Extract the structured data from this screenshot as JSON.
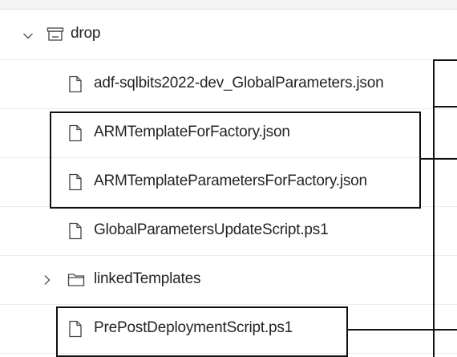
{
  "tree": {
    "root": {
      "label": "drop",
      "expanded": true
    },
    "items": [
      {
        "label": "adf-sqlbits2022-dev_GlobalParameters.json",
        "type": "file"
      },
      {
        "label": "ARMTemplateForFactory.json",
        "type": "file"
      },
      {
        "label": "ARMTemplateParametersForFactory.json",
        "type": "file"
      },
      {
        "label": "GlobalParametersUpdateScript.ps1",
        "type": "file"
      },
      {
        "label": "linkedTemplates",
        "type": "folder",
        "expanded": false
      },
      {
        "label": "PrePostDeploymentScript.ps1",
        "type": "file"
      }
    ]
  },
  "icons": {
    "root_toggle": "chevron-down-icon",
    "root_icon": "artifact-icon",
    "file_icon": "file-icon",
    "folder_toggle": "chevron-right-icon",
    "folder_icon": "folder-icon"
  },
  "colors": {
    "highlight_border": "#111111",
    "row_divider": "#ececec",
    "text": "#242424"
  }
}
